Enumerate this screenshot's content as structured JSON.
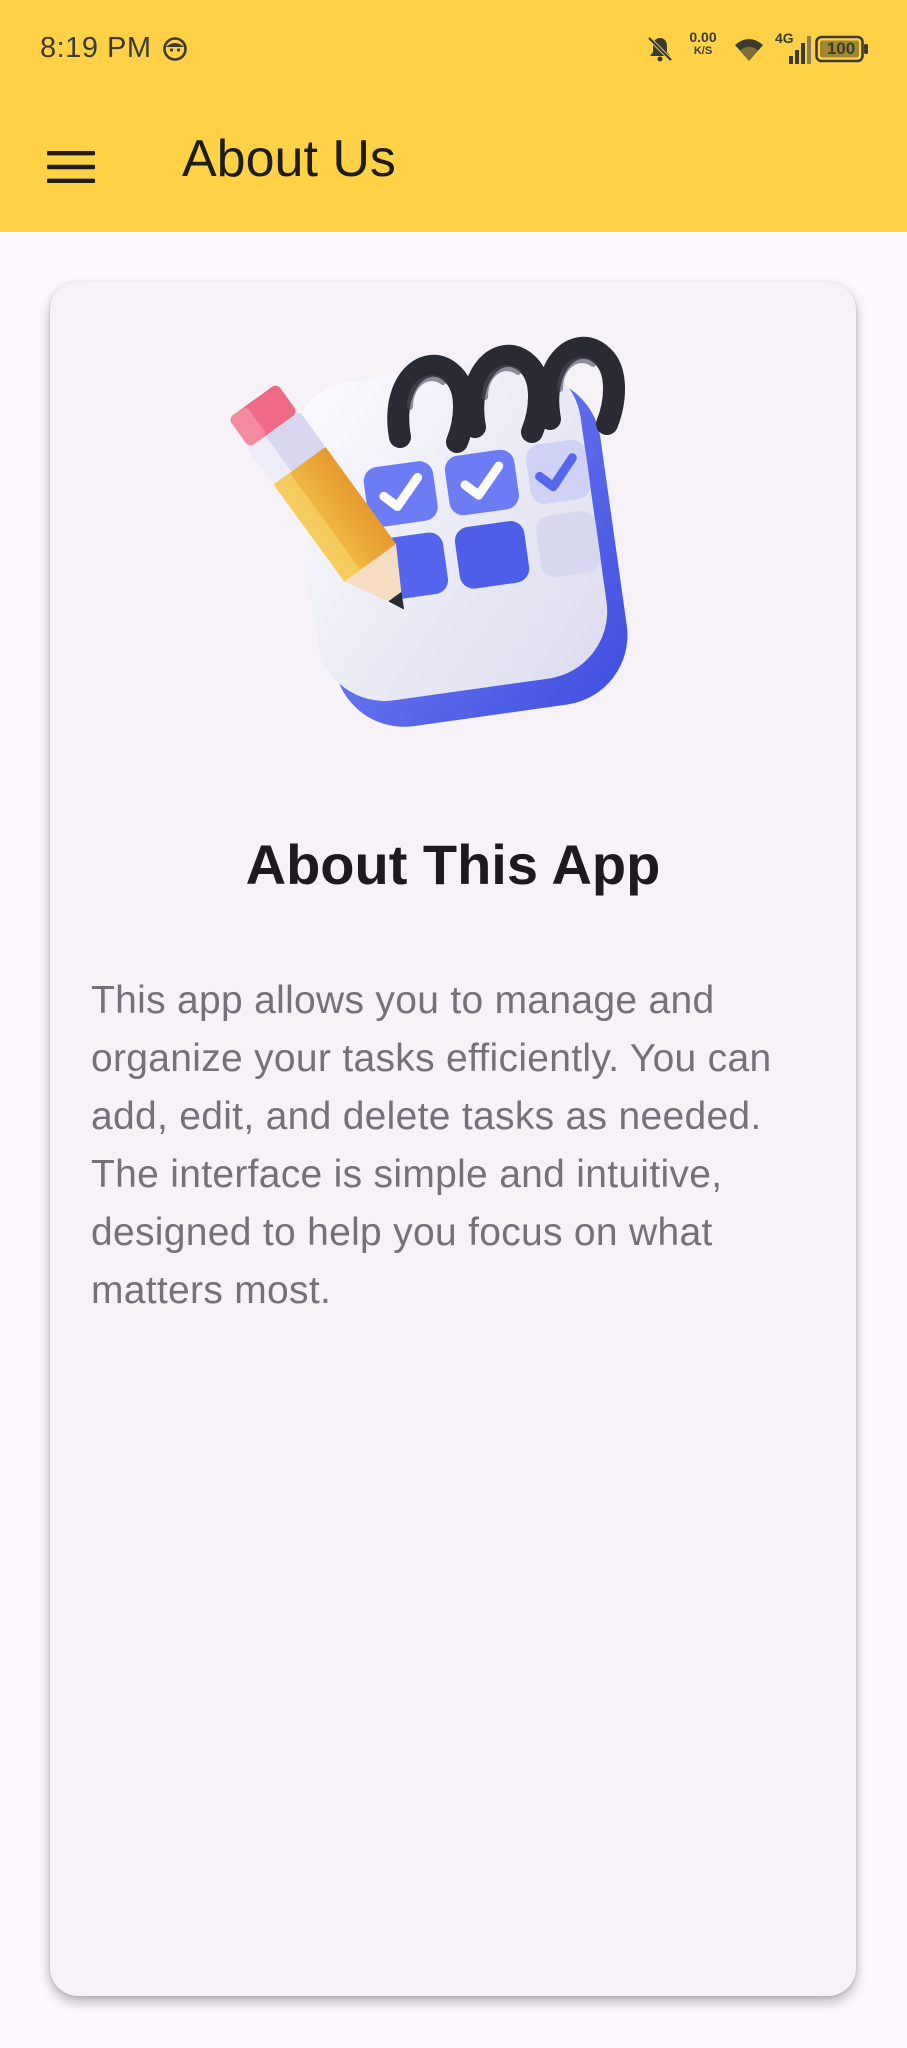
{
  "status_bar": {
    "time": "8:19 PM",
    "net_speed_value": "0.00",
    "net_speed_unit": "K/S",
    "network_type": "4G",
    "battery": "100",
    "icons": [
      "face-icon",
      "bell-off-icon",
      "wifi-icon",
      "signal-icon",
      "battery-icon"
    ]
  },
  "app_bar": {
    "title": "About Us",
    "menu_icon": "menu-icon"
  },
  "card": {
    "illustration": "calendar-checklist-pencil-illustration",
    "title": "About This App",
    "body": "This app allows you to manage and organize your tasks efficiently. You can add, edit, and delete tasks as needed. The interface is simple and intuitive, designed to help you focus on what matters most."
  },
  "colors": {
    "app_bar": "#ffd147",
    "background": "#fdf8fd",
    "card": "#f6f2f8",
    "title_text": "#1c1a1f",
    "body_text": "#75717a",
    "accent_blue": "#5a6cf0"
  }
}
